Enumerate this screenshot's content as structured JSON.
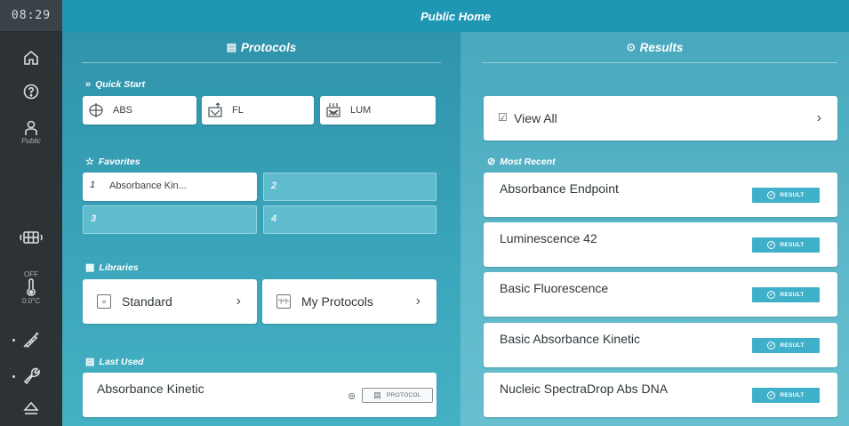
{
  "sidebar": {
    "clock": "08:29",
    "user_label": "Public",
    "temp_state": "OFF",
    "temp_value": "0.0°C"
  },
  "header": {
    "title": "Public Home"
  },
  "protocols": {
    "title": "Protocols",
    "quick_start": {
      "label": "Quick Start",
      "items": [
        {
          "label": "ABS",
          "icon": "abs-icon"
        },
        {
          "label": "FL",
          "icon": "fl-icon"
        },
        {
          "label": "LUM",
          "icon": "lum-icon"
        }
      ]
    },
    "favorites": {
      "label": "Favorites",
      "slots": [
        {
          "num": "1",
          "label": "Absorbance Kin..."
        },
        {
          "num": "2",
          "label": ""
        },
        {
          "num": "3",
          "label": ""
        },
        {
          "num": "4",
          "label": ""
        }
      ]
    },
    "libraries": {
      "label": "Libraries",
      "items": [
        {
          "label": "Standard"
        },
        {
          "label": "My Protocols"
        }
      ]
    },
    "last_used": {
      "label": "Last Used",
      "name": "Absorbance Kinetic",
      "badge": "PROTOCOL"
    }
  },
  "results": {
    "title": "Results",
    "view_all": "View All",
    "most_recent_label": "Most Recent",
    "badge_label": "RESULT",
    "items": [
      {
        "name": "Absorbance Endpoint"
      },
      {
        "name": "Luminescence 42"
      },
      {
        "name": "Basic Fluorescence"
      },
      {
        "name": "Basic Absorbance Kinetic"
      },
      {
        "name": "Nucleic SpectraDrop Abs DNA"
      }
    ]
  },
  "colors": {
    "header": "#1f97b2",
    "sidebar": "#2d3236",
    "badge": "#3fb0c9"
  }
}
